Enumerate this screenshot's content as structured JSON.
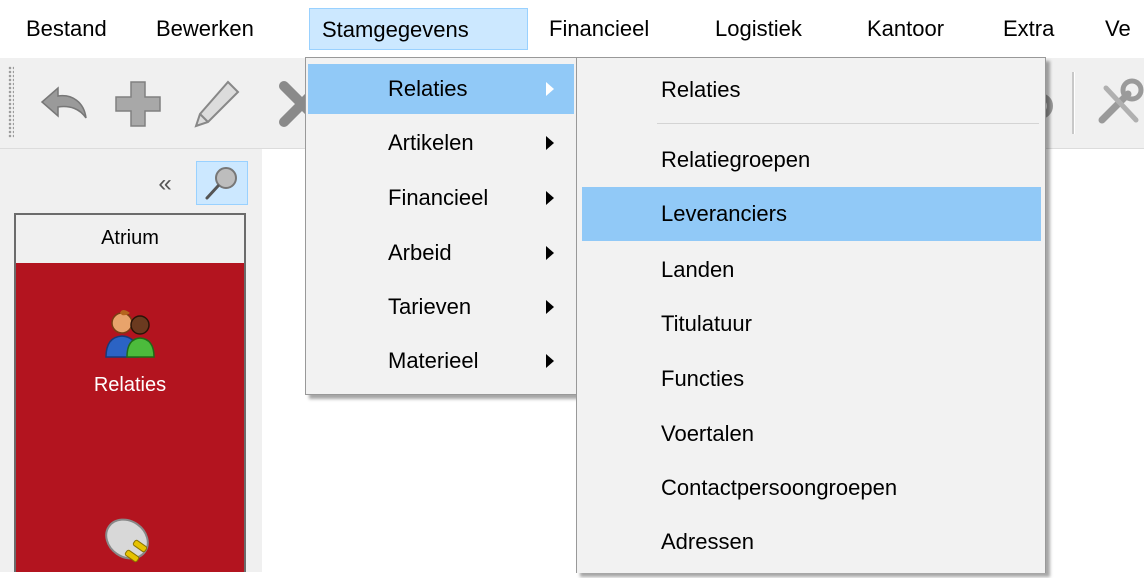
{
  "menubar": {
    "items": [
      "Bestand",
      "Bewerken",
      "Stamgegevens",
      "Financieel",
      "Logistiek",
      "Kantoor",
      "Extra",
      "Ve"
    ],
    "active_index": 2
  },
  "toolbar": {
    "icons": [
      "undo-icon",
      "add-icon",
      "edit-icon",
      "delete-icon",
      "unknown-icon",
      "tools-icon"
    ]
  },
  "left_panel": {
    "collapse_glyph": "«",
    "header": "Atrium",
    "items": [
      {
        "label": "Relaties",
        "icon": "users-icon"
      },
      {
        "label": "",
        "icon": "plug-icon"
      }
    ]
  },
  "menu_stamgegevens": {
    "items": [
      {
        "label": "Relaties",
        "submenu": true,
        "highlighted": true
      },
      {
        "label": "Artikelen",
        "submenu": true
      },
      {
        "label": "Financieel",
        "submenu": true
      },
      {
        "label": "Arbeid",
        "submenu": true
      },
      {
        "label": "Tarieven",
        "submenu": true
      },
      {
        "label": "Materieel",
        "submenu": true
      }
    ]
  },
  "menu_relaties": {
    "items": [
      {
        "label": "Relaties"
      },
      {
        "label": "Relatiegroepen"
      },
      {
        "label": "Leveranciers",
        "highlighted": true
      },
      {
        "label": "Landen"
      },
      {
        "label": "Titulatuur"
      },
      {
        "label": "Functies"
      },
      {
        "label": "Voertalen"
      },
      {
        "label": "Contactpersoongroepen"
      },
      {
        "label": "Adressen"
      }
    ]
  },
  "colors": {
    "highlight": "#91c9f7",
    "menubar_active": "#cce8ff",
    "nav_background": "#b3141f"
  }
}
